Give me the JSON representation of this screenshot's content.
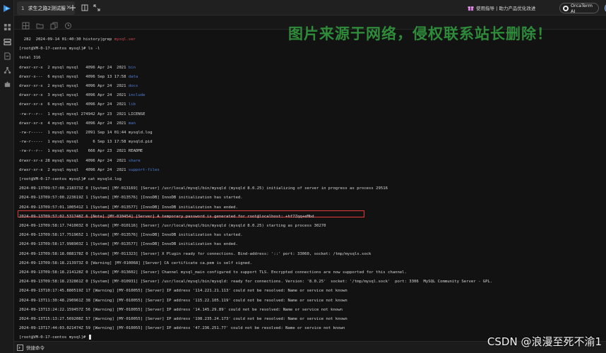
{
  "tab": {
    "index": "1",
    "title": "求生之路2测试服",
    "close": "×"
  },
  "titlebar": {
    "notice": "使用指导 | 助力产品优化改进",
    "orca_label": "OrcaTerm AI",
    "notice_icon": "gift-icon"
  },
  "status": {
    "label": "快捷命令"
  },
  "watermark": "图片来源于网络，侵权联系站长删除！",
  "csdn_credit": "CSDN @浪漫至死不渝1",
  "colors": {
    "highlight": "#e03a3a",
    "dir": "#4e7fd6",
    "grep": "#d24a4a",
    "watermark": "#2e8b3a"
  },
  "terminal": {
    "lines": [
      {
        "segs": [
          {
            "t": "  282  2024-09-14 01:40:30 history|grep "
          },
          {
            "t": "mysql.ser",
            "c": "grep"
          }
        ]
      },
      {
        "segs": [
          {
            "t": "[root@VM-0-17-centos mysql]# ls -l"
          }
        ]
      },
      {
        "segs": [
          {
            "t": "total 316"
          }
        ]
      },
      {
        "segs": [
          {
            "t": "drwxr-xr-x  2 mysql mysql   4096 Apr 24  2021 "
          },
          {
            "t": "bin",
            "c": "dir"
          }
        ]
      },
      {
        "segs": [
          {
            "t": "drwxr-x---  6 mysql mysql   4096 Sep 13 17:58 "
          },
          {
            "t": "data",
            "c": "dir"
          }
        ]
      },
      {
        "segs": [
          {
            "t": "drwxr-xr-x  2 mysql mysql   4096 Apr 24  2021 "
          },
          {
            "t": "docs",
            "c": "dir"
          }
        ]
      },
      {
        "segs": [
          {
            "t": "drwxr-xr-x  3 mysql mysql   4096 Apr 24  2021 "
          },
          {
            "t": "include",
            "c": "dir"
          }
        ]
      },
      {
        "segs": [
          {
            "t": "drwxr-xr-x  6 mysql mysql   4096 Apr 24  2021 "
          },
          {
            "t": "lib",
            "c": "dir"
          }
        ]
      },
      {
        "segs": [
          {
            "t": "-rw-r--r--  1 mysql mysql 274942 Apr 23  2021 LICENSE"
          }
        ]
      },
      {
        "segs": [
          {
            "t": "drwxr-xr-x  4 mysql mysql   4096 Apr 24  2021 "
          },
          {
            "t": "man",
            "c": "dir"
          }
        ]
      },
      {
        "segs": [
          {
            "t": "-rw-r-----  1 mysql mysql   2091 Sep 14 01:44 mysqld.log"
          }
        ]
      },
      {
        "segs": [
          {
            "t": "-rw-r-----  1 mysql mysql      6 Sep 13 17:58 mysqld.pid"
          }
        ]
      },
      {
        "segs": [
          {
            "t": "-rw-r--r--  1 mysql mysql    666 Apr 23  2021 README"
          }
        ]
      },
      {
        "segs": [
          {
            "t": "drwxr-xr-x 28 mysql mysql   4096 Apr 24  2021 "
          },
          {
            "t": "share",
            "c": "dir"
          }
        ]
      },
      {
        "segs": [
          {
            "t": "drwxr-xr-x  2 mysql mysql   4096 Apr 24  2021 "
          },
          {
            "t": "support-files",
            "c": "dir"
          }
        ]
      },
      {
        "segs": [
          {
            "t": "[root@VM-0-17-centos mysql]# cat mysqld.log"
          }
        ]
      },
      {
        "segs": [
          {
            "t": "2024-09-13T09:57:00.218373Z 0 [System] [MY-013169] [Server] /usr/local/mysql/bin/mysqld (mysqld 8.0.25) initializing of server in progress as process 29516"
          }
        ]
      },
      {
        "segs": [
          {
            "t": "2024-09-13T09:57:00.223619Z 1 [System] [MY-013576] [InnoDB] InnoDB initialization has started."
          }
        ]
      },
      {
        "segs": [
          {
            "t": "2024-09-13T09:57:01.100541Z 1 [System] [MY-013577] [InnoDB] InnoDB initialization has ended."
          }
        ]
      },
      {
        "segs": [
          {
            "t": "2024-09-13T09:57:02.531748Z 6 [Note] [MY-010454] [Server] A temporary password is generated for root@localhost: +hf7Zqq+eMbd"
          }
        ]
      },
      {
        "segs": [
          {
            "t": "2024-09-13T09:58:17.741003Z 0 [System] [MY-010116] [Server] /usr/local/mysql/bin/mysqld (mysqld 8.0.25) starting as process 30270"
          }
        ]
      },
      {
        "segs": [
          {
            "t": "2024-09-13T09:58:17.751965Z 1 [System] [MY-013576] [InnoDB] InnoDB initialization has started."
          }
        ]
      },
      {
        "segs": [
          {
            "t": "2024-09-13T09:58:17.998903Z 1 [System] [MY-013577] [InnoDB] InnoDB initialization has ended."
          }
        ]
      },
      {
        "segs": [
          {
            "t": "2024-09-13T09:58:18.088178Z 0 [System] [MY-011323] [Server] X Plugin ready for connections. Bind-address: '::' port: 33060, socket: /tmp/mysqlx.sock"
          }
        ]
      },
      {
        "segs": [
          {
            "t": "2024-09-13T09:58:18.213973Z 0 [Warning] [MY-010068] [Server] CA certificate ca.pem is self signed."
          }
        ]
      },
      {
        "segs": [
          {
            "t": "2024-09-13T09:58:18.214128Z 0 [System] [MY-013602] [Server] Channel mysql_main configured to support TLS. Encrypted connections are now supported for this channel."
          }
        ]
      },
      {
        "segs": [
          {
            "t": "2024-09-13T09:58:18.232861Z 0 [System] [MY-010931] [Server] /usr/local/mysql/bin/mysqld: ready for connections. Version: '8.0.25'  socket: '/tmp/mysql.sock'  port: 3306  MySQL Community Server - GPL."
          }
        ]
      },
      {
        "segs": [
          {
            "t": "2024-09-13T10:17:45.880519Z 17 [Warning] [MY-010055] [Server] IP address '114.221.21.113' could not be resolved: Name or service not known"
          }
        ]
      },
      {
        "segs": [
          {
            "t": "2024-09-13T11:30:48.290961Z 38 [Warning] [MY-010055] [Server] IP address '115.22.105.119' could not be resolved: Name or service not known"
          }
        ]
      },
      {
        "segs": [
          {
            "t": "2024-09-13T13:24:22.159457Z 56 [Warning] [MY-010055] [Server] IP address '14.145.29.89' could not be resolved: Name or service not known"
          }
        ]
      },
      {
        "segs": [
          {
            "t": "2024-09-13T15:13:27.569208Z 57 [Warning] [MY-010055] [Server] IP address '198.235.24.173' could not be resolved: Name or service not known"
          }
        ]
      },
      {
        "segs": [
          {
            "t": "2024-09-13T17:44:03.021474Z 59 [Warning] [MY-010055] [Server] IP address '47.236.251.77' could not be resolved: Name or service not known"
          }
        ]
      },
      {
        "segs": [
          {
            "t": "[root@VM-0-17-centos mysql]# "
          }
        ],
        "cursor": true
      }
    ]
  }
}
